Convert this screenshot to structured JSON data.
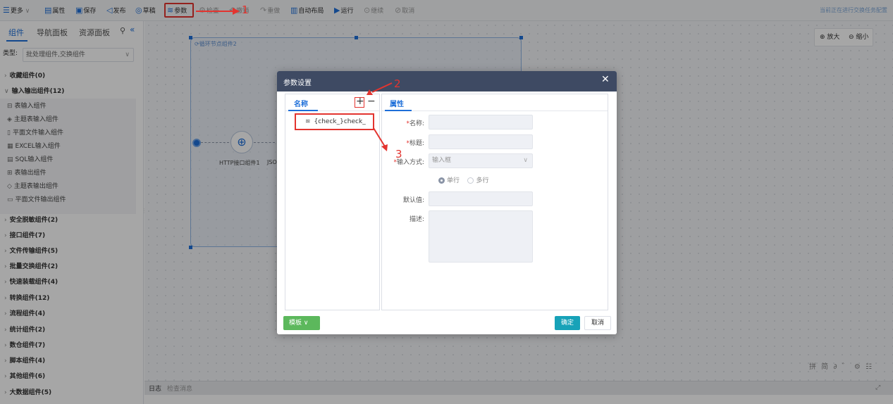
{
  "toolbar": {
    "more": "更多",
    "properties": "属性",
    "save": "保存",
    "publish": "发布",
    "draft": "草稿",
    "params": "参数",
    "check": "检查",
    "undo": "撤销",
    "redo": "重做",
    "auto_layout": "自动布局",
    "run": "运行",
    "continue": "继续",
    "cancel": "取消",
    "status": "当前正在进行交换任务配置"
  },
  "left_panel": {
    "tabs": [
      "组件",
      "导航面板",
      "资源面板"
    ],
    "type_label": "类型:",
    "type_value": "批处理组件,交换组件",
    "categories": [
      "收藏组件(0)",
      "输入输出组件(12)",
      "安全脱敏组件(2)",
      "接口组件(7)",
      "文件传输组件(5)",
      "批量交换组件(2)",
      "快速装载组件(4)",
      "转换组件(12)",
      "流程组件(4)",
      "统计组件(2)",
      "数仓组件(7)",
      "脚本组件(4)",
      "其他组件(6)",
      "大数据组件(5)"
    ],
    "io_items": [
      "表输入组件",
      "主题表输入组件",
      "平面文件输入组件",
      "EXCEL输入组件",
      "SQL输入组件",
      "表输出组件",
      "主题表输出组件",
      "平面文件输出组件"
    ]
  },
  "canvas": {
    "zoom_in": "放大",
    "zoom_out": "缩小",
    "loop_label": "循环节点组件2",
    "http_node_label": "HTTP接口组件1",
    "json_node_label": "JSO",
    "bottom_tabs": [
      "日志",
      "检查消息"
    ],
    "ime_text": "拼 简 ∂ ゛ ⚙ ☷"
  },
  "dialog": {
    "title": "参数设置",
    "name_header": "名称",
    "props_header": "属性",
    "param_item": "{check_}check_",
    "fields": {
      "name_label": "名称:",
      "title_label": "标题:",
      "input_mode_label": "输入方式:",
      "input_mode_value": "输入框",
      "single_line": "单行",
      "multi_line": "多行",
      "default_label": "默认值:",
      "desc_label": "描述:"
    },
    "template_btn": "模板",
    "ok_btn": "确定",
    "cancel_btn": "取消"
  },
  "annotations": [
    "1",
    "2",
    "3"
  ]
}
